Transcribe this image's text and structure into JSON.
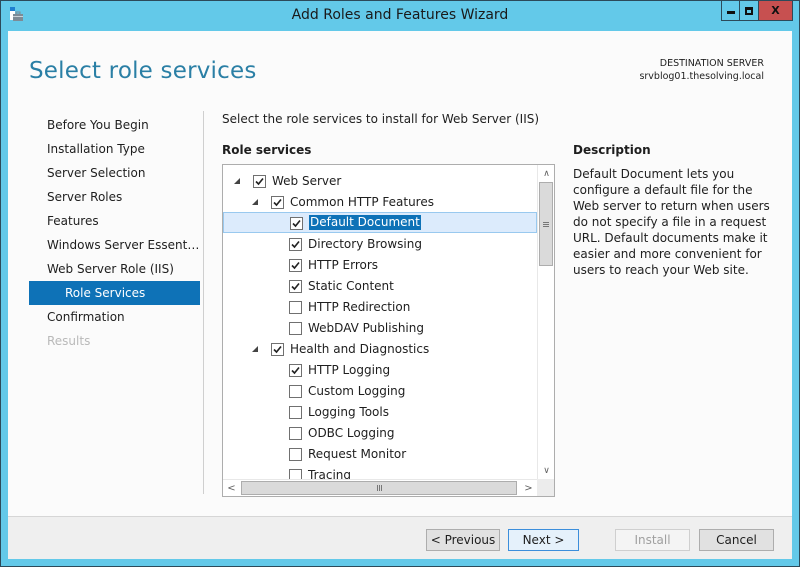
{
  "window": {
    "title": "Add Roles and Features Wizard",
    "controls": {
      "minimize": "minimize",
      "maximize": "maximize",
      "close": "X"
    }
  },
  "header": {
    "title": "Select role services",
    "destination_label": "DESTINATION SERVER",
    "destination_server": "srvblog01.thesolving.local"
  },
  "nav": {
    "items": [
      {
        "label": "Before You Begin",
        "state": "normal"
      },
      {
        "label": "Installation Type",
        "state": "normal"
      },
      {
        "label": "Server Selection",
        "state": "normal"
      },
      {
        "label": "Server Roles",
        "state": "normal"
      },
      {
        "label": "Features",
        "state": "normal"
      },
      {
        "label": "Windows Server Essential...",
        "state": "normal"
      },
      {
        "label": "Web Server Role (IIS)",
        "state": "normal"
      },
      {
        "label": "Role Services",
        "state": "active"
      },
      {
        "label": "Confirmation",
        "state": "normal"
      },
      {
        "label": "Results",
        "state": "disabled"
      }
    ]
  },
  "main": {
    "instruction": "Select the role services to install for Web Server (IIS)",
    "role_services_label": "Role services",
    "tree": [
      {
        "label": "Web Server",
        "level": 0,
        "expandable": true,
        "checked": true,
        "selected": false
      },
      {
        "label": "Common HTTP Features",
        "level": 1,
        "expandable": true,
        "checked": true,
        "selected": false
      },
      {
        "label": "Default Document",
        "level": 2,
        "expandable": false,
        "checked": true,
        "selected": true
      },
      {
        "label": "Directory Browsing",
        "level": 2,
        "expandable": false,
        "checked": true,
        "selected": false
      },
      {
        "label": "HTTP Errors",
        "level": 2,
        "expandable": false,
        "checked": true,
        "selected": false
      },
      {
        "label": "Static Content",
        "level": 2,
        "expandable": false,
        "checked": true,
        "selected": false
      },
      {
        "label": "HTTP Redirection",
        "level": 2,
        "expandable": false,
        "checked": false,
        "selected": false
      },
      {
        "label": "WebDAV Publishing",
        "level": 2,
        "expandable": false,
        "checked": false,
        "selected": false
      },
      {
        "label": "Health and Diagnostics",
        "level": 1,
        "expandable": true,
        "checked": true,
        "selected": false
      },
      {
        "label": "HTTP Logging",
        "level": 2,
        "expandable": false,
        "checked": true,
        "selected": false
      },
      {
        "label": "Custom Logging",
        "level": 2,
        "expandable": false,
        "checked": false,
        "selected": false
      },
      {
        "label": "Logging Tools",
        "level": 2,
        "expandable": false,
        "checked": false,
        "selected": false
      },
      {
        "label": "ODBC Logging",
        "level": 2,
        "expandable": false,
        "checked": false,
        "selected": false
      },
      {
        "label": "Request Monitor",
        "level": 2,
        "expandable": false,
        "checked": false,
        "selected": false
      },
      {
        "label": "Tracing",
        "level": 2,
        "expandable": false,
        "checked": false,
        "selected": false
      }
    ],
    "description_label": "Description",
    "description": "Default Document lets you configure a default file for the Web server to return when users do not specify a file in a request URL. Default documents make it easier and more convenient for users to reach your Web site."
  },
  "footer": {
    "previous": "< Previous",
    "next": "Next >",
    "install": "Install",
    "cancel": "Cancel"
  },
  "colors": {
    "accent": "#0e72b7",
    "title_bar": "#63c9e9",
    "close_button": "#c75050",
    "header_title": "#2a7fa5"
  }
}
